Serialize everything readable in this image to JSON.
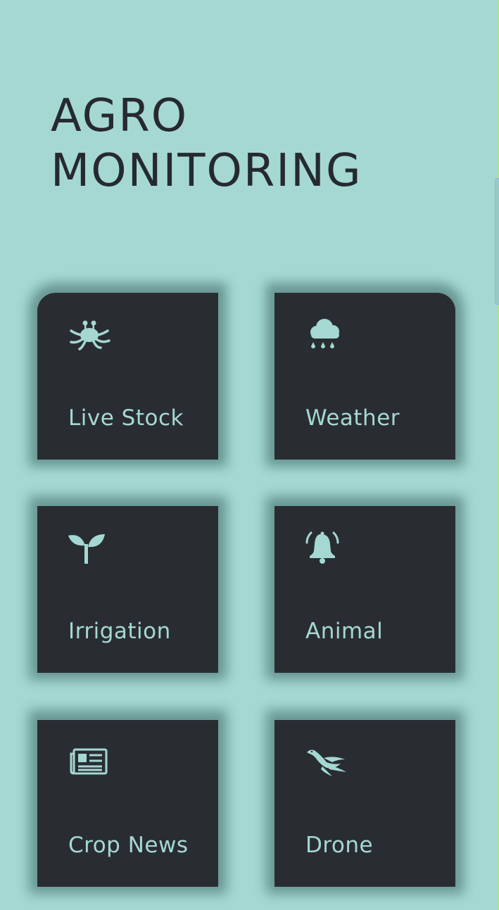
{
  "app": {
    "title_line1": "AGRO",
    "title_line2": "MONITORING"
  },
  "colors": {
    "background": "#a5d8d3",
    "tile": "#292d32",
    "accent": "#a5d8d3",
    "title": "#262a30"
  },
  "tiles": [
    {
      "label": "Live Stock",
      "icon": "octopus-icon"
    },
    {
      "label": "Weather",
      "icon": "rain-cloud-icon"
    },
    {
      "label": "Irrigation",
      "icon": "seedling-icon"
    },
    {
      "label": "Animal",
      "icon": "bell-alert-icon"
    },
    {
      "label": "Crop News",
      "icon": "newspaper-icon"
    },
    {
      "label": "Drone",
      "icon": "bird-icon"
    }
  ]
}
